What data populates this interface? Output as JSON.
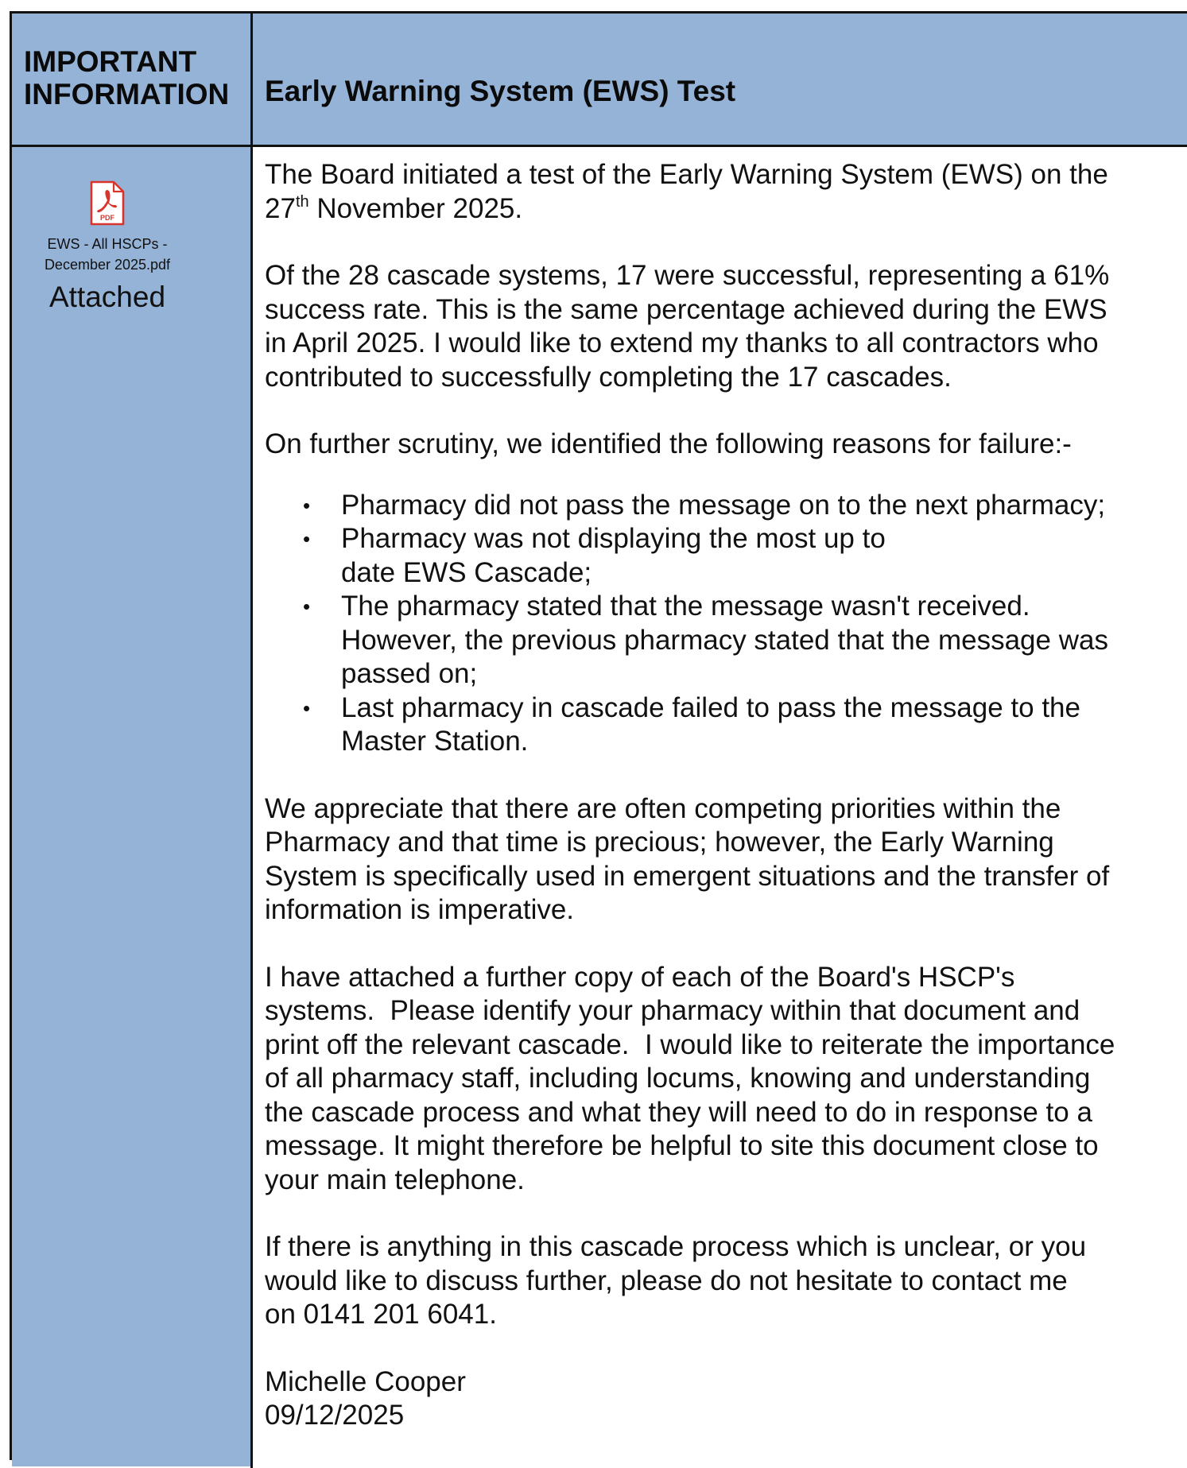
{
  "header": {
    "label_line1": "IMPORTANT",
    "label_line2": "INFORMATION",
    "title": "Early Warning System (EWS) Test"
  },
  "attachment": {
    "icon": "pdf-icon",
    "icon_text": "PDF",
    "file_name_line1": "EWS - All HSCPs -",
    "file_name_line2": "December 2025.pdf",
    "status": "Attached"
  },
  "body": {
    "intro": {
      "line1": "The Board initiated a test of the Early Warning System (EWS) on the",
      "day": "27",
      "ordinal": "th",
      "line2_rest": " November 2025."
    },
    "para2": [
      "Of the 28 cascade systems, 17 were successful, representing a 61%",
      "success rate. This is the same percentage achieved during the EWS",
      "in April 2025. I would like to extend my thanks to all contractors who",
      "contributed to successfully completing the 17 cascades."
    ],
    "para3": "On further scrutiny, we identified the following reasons for failure:-",
    "reasons": [
      [
        "Pharmacy did not pass the message on to the next pharmacy;"
      ],
      [
        "Pharmacy was not displaying the most up to",
        "date EWS Cascade;"
      ],
      [
        "The pharmacy stated that the message wasn't received.",
        "However, the previous pharmacy stated that the message was",
        "passed on;"
      ],
      [
        "Last pharmacy in cascade failed to pass the message to the",
        "Master Station."
      ]
    ],
    "para4": [
      "We appreciate that there are often competing priorities within the",
      "Pharmacy and that time is precious; however, the Early Warning",
      "System is specifically used in emergent situations and the transfer of",
      "information is imperative."
    ],
    "para5": [
      "I have attached a further copy of each of the Board's HSCP's",
      "systems.  Please identify your pharmacy within that document and",
      "print off the relevant cascade.  I would like to reiterate the importance",
      "of all pharmacy staff, including locums, knowing and understanding",
      "the cascade process and what they will need to do in response to a",
      "message. It might therefore be helpful to site this document close to",
      "your main telephone."
    ],
    "para6": [
      "If there is anything in this cascade process which is unclear, or you",
      "would like to discuss further, please do not hesitate to contact me",
      "on 0141 201 6041."
    ],
    "signature": {
      "name": "Michelle Cooper",
      "date": "09/12/2025"
    }
  }
}
